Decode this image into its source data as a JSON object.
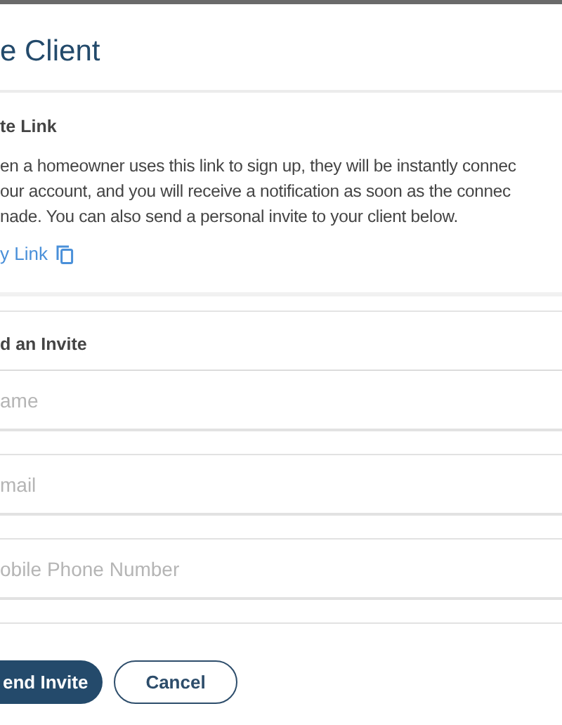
{
  "dialog": {
    "title": "e Client"
  },
  "invite_link": {
    "heading": "te Link",
    "description_lines": [
      "en a homeowner uses this link to sign up, they will be instantly connec",
      "our account, and you will receive a notification as soon as the connec",
      "nade. You can also send a personal invite to your client below."
    ],
    "copy_link": "y Link"
  },
  "send_invite": {
    "heading": "d an Invite",
    "fields": [
      {
        "placeholder": "ame"
      },
      {
        "placeholder": "mail"
      },
      {
        "placeholder": "obile Phone Number"
      }
    ]
  },
  "buttons": [
    {
      "label": "end Invite",
      "kind": "primary"
    },
    {
      "label": "Cancel",
      "kind": "secondary"
    }
  ]
}
